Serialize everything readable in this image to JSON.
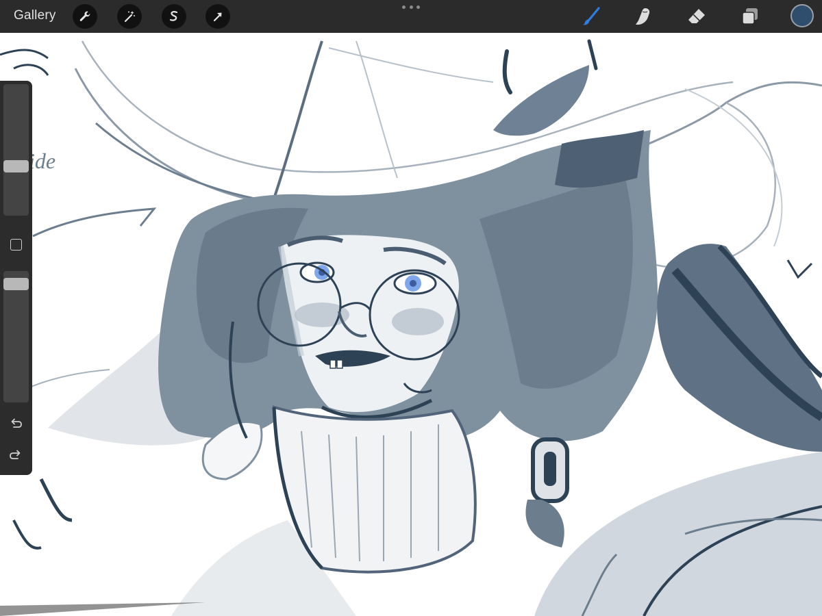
{
  "topbar": {
    "gallery_label": "Gallery",
    "left_tools": [
      {
        "name": "actions",
        "icon": "wrench-icon"
      },
      {
        "name": "adjustments",
        "icon": "magic-wand-icon"
      },
      {
        "name": "selection",
        "icon": "selection-s-icon"
      },
      {
        "name": "transform",
        "icon": "arrow-cursor-icon"
      }
    ],
    "right_tools": [
      {
        "name": "brush",
        "icon": "brush-icon",
        "active": true
      },
      {
        "name": "smudge",
        "icon": "smudge-finger-icon",
        "active": false
      },
      {
        "name": "eraser",
        "icon": "eraser-icon",
        "active": false
      },
      {
        "name": "layers",
        "icon": "layers-icon",
        "active": false
      }
    ],
    "active_color": "#2f4d6d",
    "accent_color": "#2f7de1"
  },
  "sidebar": {
    "brush_size_level": 0.36,
    "brush_opacity_level": 0.94,
    "modify_icon": "square-outline-icon",
    "undo_icon": "undo-arrow-icon",
    "redo_icon": "redo-arrow-icon"
  },
  "canvas": {
    "sketch_text": "ide",
    "ink_colors": {
      "dark": "#2e4256",
      "mid": "#6c7d8e",
      "light": "#b9c3cd",
      "iris": "#7fa7ec"
    }
  }
}
